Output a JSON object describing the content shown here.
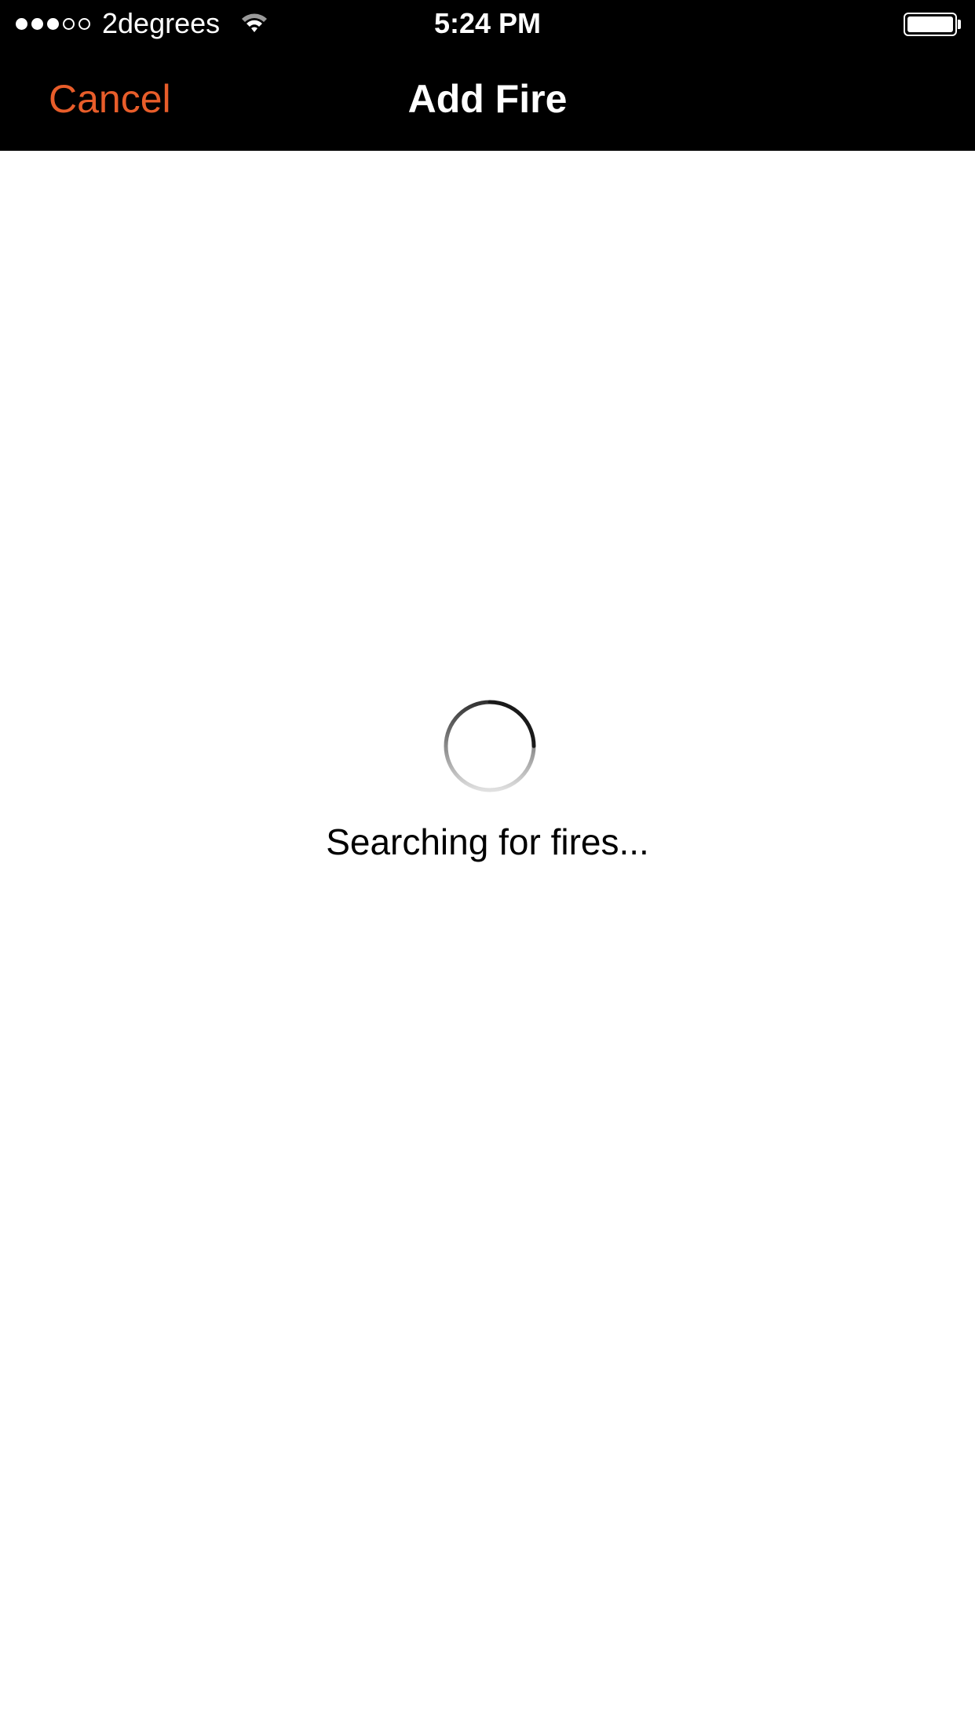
{
  "status_bar": {
    "signal_bars_filled": 3,
    "signal_bars_total": 5,
    "carrier": "2degrees",
    "time": "5:24 PM",
    "battery_level": 1.0,
    "wifi_icon": "wifi-icon",
    "battery_icon": "battery-icon"
  },
  "nav": {
    "cancel_label": "Cancel",
    "title": "Add Fire"
  },
  "content": {
    "loading_text": "Searching for fires...",
    "spinner_icon": "spinner-icon"
  },
  "colors": {
    "accent": "#e85d2a",
    "bar_background": "#000000",
    "page_background": "#ffffff"
  }
}
